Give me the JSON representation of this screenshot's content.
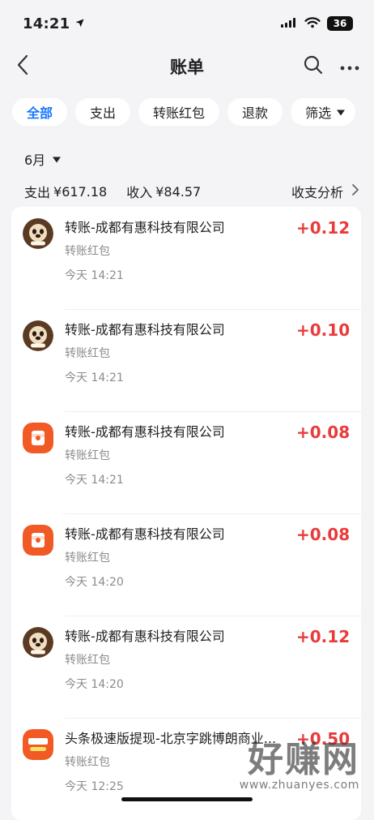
{
  "status_bar": {
    "time": "14:21",
    "battery": "36"
  },
  "header": {
    "title": "账单"
  },
  "filters": [
    {
      "label": "全部",
      "active": true
    },
    {
      "label": "支出",
      "active": false
    },
    {
      "label": "转账红包",
      "active": false
    },
    {
      "label": "退款",
      "active": false
    }
  ],
  "filter_button_label": "筛选",
  "summary": {
    "month": "6月",
    "expense_label": "支出",
    "expense_amount": "¥617.18",
    "income_label": "收入",
    "income_amount": "¥84.57",
    "analysis_label": "收支分析"
  },
  "transactions": [
    {
      "title": "转账-成都有惠科技有限公司",
      "subtitle": "转账红包",
      "time": "今天 14:21",
      "amount": "+0.12",
      "icon": "cartoon-bear-icon"
    },
    {
      "title": "转账-成都有惠科技有限公司",
      "subtitle": "转账红包",
      "time": "今天 14:21",
      "amount": "+0.10",
      "icon": "cartoon-bear-icon"
    },
    {
      "title": "转账-成都有惠科技有限公司",
      "subtitle": "转账红包",
      "time": "今天 14:21",
      "amount": "+0.08",
      "icon": "red-envelope-icon"
    },
    {
      "title": "转账-成都有惠科技有限公司",
      "subtitle": "转账红包",
      "time": "今天 14:20",
      "amount": "+0.08",
      "icon": "red-envelope-icon"
    },
    {
      "title": "转账-成都有惠科技有限公司",
      "subtitle": "转账红包",
      "time": "今天 14:20",
      "amount": "+0.12",
      "icon": "cartoon-bear-icon"
    },
    {
      "title": "头条极速版提现-北京字跳博朗商业...",
      "subtitle": "转账红包",
      "time": "今天 12:25",
      "amount": "+0.50",
      "icon": "toutiao-logo-icon"
    }
  ],
  "watermark": {
    "main": "好赚网",
    "sub": "www.zhuanyes.com"
  },
  "colors": {
    "background": "#f4f4f6",
    "accent_blue": "#1677ff",
    "income_red": "#ea3b3b",
    "secondary_text": "#8c8c8c",
    "brand_orange": "#f15a24"
  }
}
